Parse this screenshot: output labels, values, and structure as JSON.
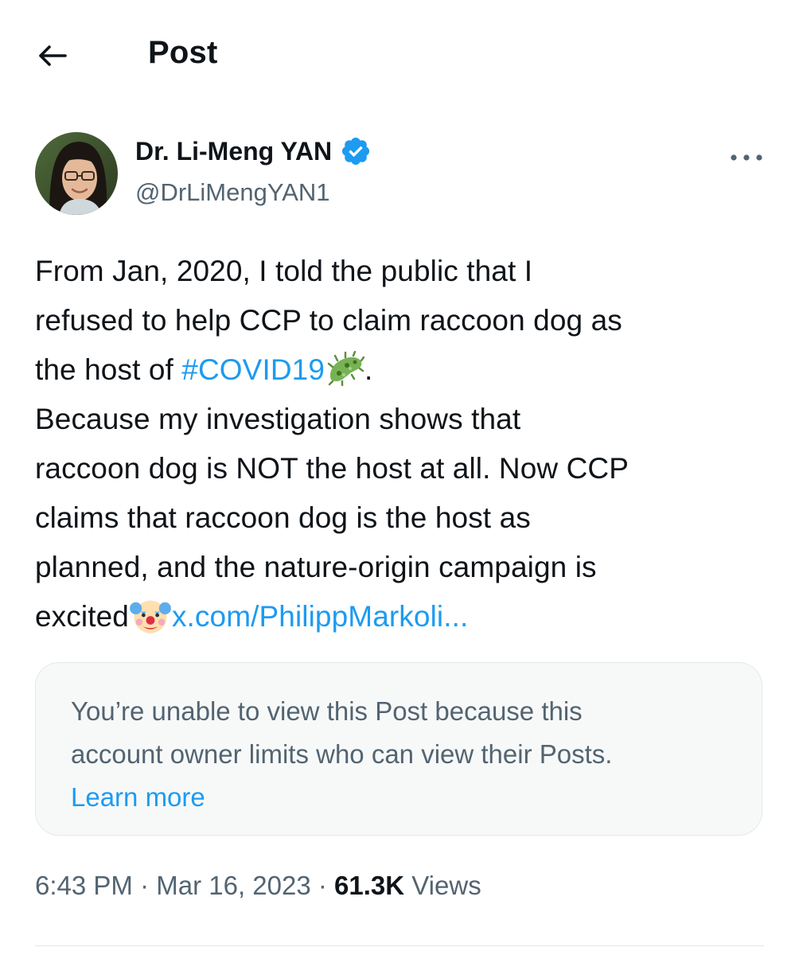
{
  "header": {
    "title": "Post",
    "back_icon": "arrow-left-icon"
  },
  "author": {
    "name": "Dr. Li-Meng YAN",
    "handle": "@DrLiMengYAN1",
    "verified_icon": "verified-badge-icon",
    "verified_color": "#1d9bf0",
    "avatar_icon": "avatar-photo"
  },
  "more_icon": "more-dots-icon",
  "tweet": {
    "line1": "From Jan, 2020, I told the public that I",
    "line2": "refused to help CCP to claim raccoon dog as",
    "line3_pre": "the host of ",
    "hashtag": "#COVID19",
    "emoji_microbe": "microbe-emoji",
    "line3_post": ".",
    "line4": "Because my investigation shows that",
    "line5": "raccoon dog is NOT the host at all. Now CCP",
    "line6": "claims that raccoon dog is the host as",
    "line7": "planned, and the nature-origin campaign is",
    "line8_pre": "excited",
    "emoji_clown": "clown-face-emoji",
    "link": "x.com/PhilippMarkoli..."
  },
  "quoted_post": {
    "line1": "You’re unable to view this Post because this",
    "line2": "account owner limits who can view their Posts.",
    "learn_more": "Learn more"
  },
  "meta": {
    "time": "6:43 PM",
    "sep1": " · ",
    "date": "Mar 16, 2023",
    "sep2": " · ",
    "views_count": "61.3K",
    "views_label": " Views"
  },
  "colors": {
    "accent": "#1d9bf0",
    "text": "#0f1419",
    "secondary": "#536471",
    "card_bg": "#f7f9f9"
  }
}
